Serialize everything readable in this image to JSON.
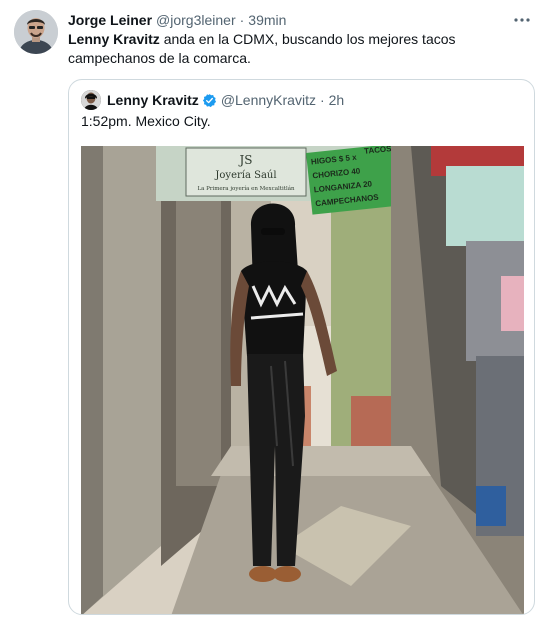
{
  "tweet": {
    "author_name": "Jorge Leiner",
    "author_handle": "@jorg3leiner",
    "separator": "·",
    "time": "39min",
    "text_bold": "Lenny Kravitz",
    "text_rest": " anda en la CDMX, buscando los mejores tacos campechanos de la comarca.",
    "more_icon": "more-horizontal-icon"
  },
  "quoted_tweet": {
    "author_name": "Lenny Kravitz",
    "verified_icon": "verified-badge-icon",
    "author_handle": "@LennyKravitz",
    "separator": "·",
    "time": "2h",
    "text": "1:52pm. Mexico City."
  },
  "photo": {
    "store_sign": "JS",
    "store_sign_sub": "Joyería Saúl",
    "store_sign_tagline": "La Primera joyería en Mexcaltitlán",
    "taco_sign_line1": "TACOS",
    "taco_sign_line2": "HIGOS $ 5 x",
    "taco_sign_line3": "CHORIZO 40",
    "taco_sign_line4": "LONGANIZA 20",
    "taco_sign_line5": "CAMPECHANOS"
  },
  "colors": {
    "text_primary": "#0f1419",
    "text_secondary": "#536471",
    "border": "#cfd9de",
    "verified_blue": "#1d9bf0"
  }
}
